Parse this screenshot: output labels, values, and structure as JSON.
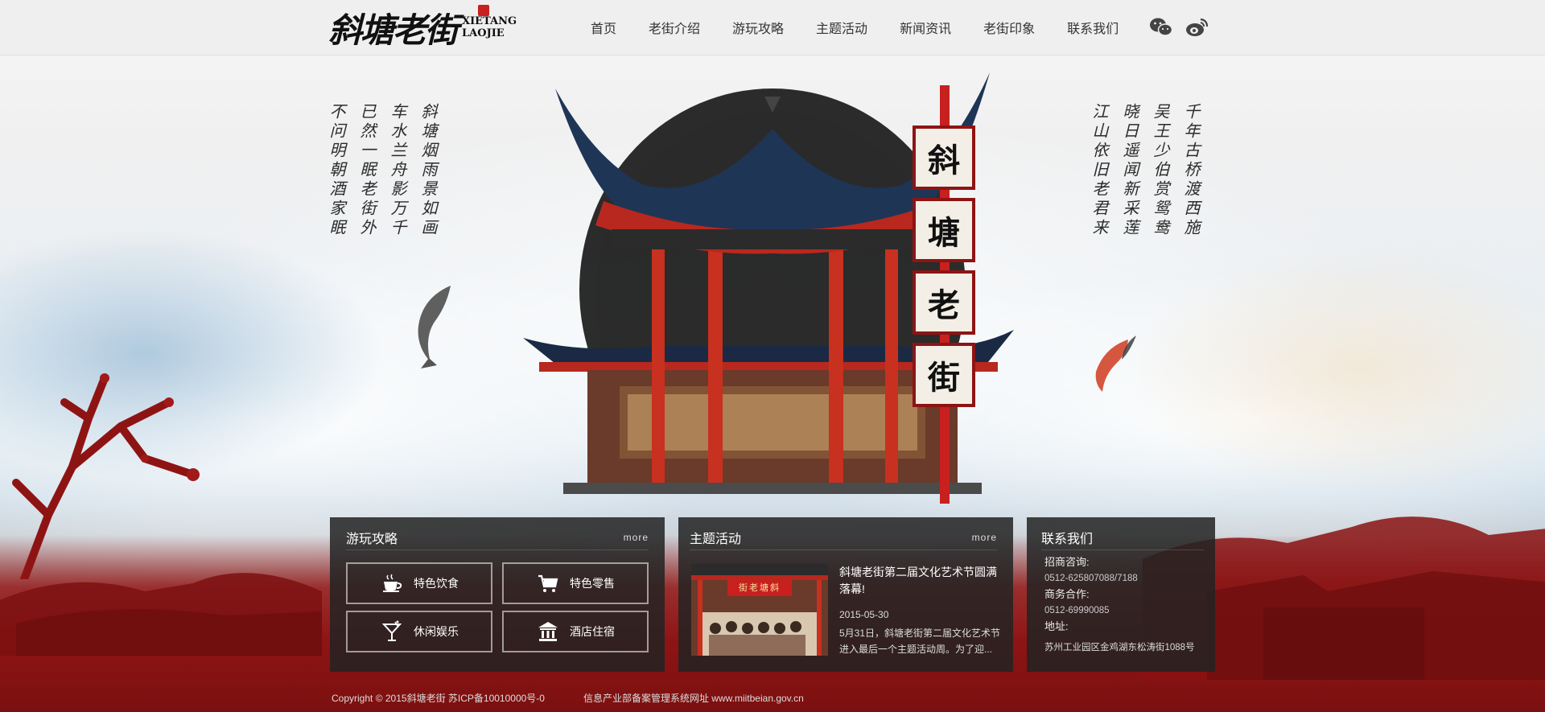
{
  "brand": {
    "logo_cn": "斜塘老街",
    "logo_en_line1": "XIETANG",
    "logo_en_line2": "LAOJIE"
  },
  "nav": {
    "items": [
      "首页",
      "老街介绍",
      "游玩攻略",
      "主题活动",
      "新闻资讯",
      "老街印象",
      "联系我们"
    ]
  },
  "social": {
    "icons": [
      "wechat-icon",
      "weibo-icon"
    ]
  },
  "poems": {
    "left": [
      "斜塘烟雨景如画",
      "车水兰舟影万千",
      "已然一眠老街外",
      "不问明朝酒家眠"
    ],
    "right": [
      "千年古桥渡西施",
      "吴王少伯赏鸳鸯",
      "晓日遥闻新采莲",
      "江山依旧老君来"
    ]
  },
  "sign": {
    "chars": [
      "斜",
      "塘",
      "老",
      "街"
    ]
  },
  "guide": {
    "title": "游玩攻略",
    "more": "more",
    "tiles": [
      {
        "label": "特色饮食",
        "icon": "coffee-cup-icon"
      },
      {
        "label": "特色零售",
        "icon": "shopping-cart-icon"
      },
      {
        "label": "休闲娱乐",
        "icon": "cocktail-glass-icon"
      },
      {
        "label": "酒店住宿",
        "icon": "hotel-building-icon"
      }
    ]
  },
  "event": {
    "title": "主题活动",
    "more": "more",
    "headline": "斜塘老街第二届文化艺术节圆满落幕!",
    "date": "2015-05-30",
    "desc": "5月31日，斜塘老街第二届文化艺术节进入最后一个主题活动周。为了迎...",
    "thumb_sign": "街老塘斜"
  },
  "contact": {
    "title": "联系我们",
    "invest_label": "招商咨询:",
    "invest_phone": "0512-625807088/7188",
    "biz_label": "商务合作:",
    "biz_phone": "0512-69990085",
    "addr_label": "地址:",
    "addr": "苏州工业园区金鸡湖东松涛街1088号"
  },
  "footer": {
    "copyright": "Copyright © 2015斜塘老街 苏ICP备10010000号-0",
    "ministry": "信息产业部备案管理系统网址 www.miitbeian.gov.cn"
  },
  "colors": {
    "brand_red": "#8e1414",
    "seal_red": "#c8201e",
    "panel_bg": "#232323",
    "topbar_bg": "#eeeeee"
  }
}
